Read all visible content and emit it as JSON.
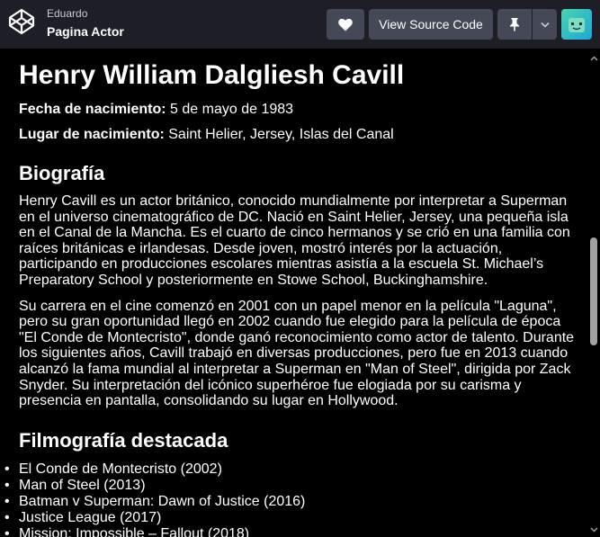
{
  "header": {
    "author": "Eduardo",
    "pen_title": "Pagina Actor",
    "source_label": "View Source Code"
  },
  "page": {
    "name": "Henry William Dalgliesh Cavill",
    "birth_label": "Fecha de nacimiento:",
    "birth_value": " 5 de mayo de 1983",
    "place_label": "Lugar de nacimiento:",
    "place_value": " Saint Helier, Jersey, Islas del Canal",
    "bio_heading": "Biografía",
    "bio_p1": "Henry Cavill es un actor británico, conocido mundialmente por interpretar a Superman en el universo cinematográfico de DC. Nació en Saint Helier, Jersey, una pequeña isla en el Canal de la Mancha. Es el cuarto de cinco hermanos y se crió en una familia con raíces británicas e irlandesas. Desde joven, mostró interés por la actuación, participando en producciones escolares mientras asistía a la escuela St. Michael’s Preparatory School y posteriormente en Stowe School, Buckinghamshire.",
    "bio_p2": "Su carrera en el cine comenzó en 2001 con un papel menor en la película \"Laguna\", pero su gran oportunidad llegó en 2002 cuando fue elegido para la película de época \"El Conde de Montecristo\", donde ganó reconocimiento como actor de talento. Durante los siguientes años, Cavill trabajó en diversas producciones, pero fue en 2013 cuando alcanzó la fama mundial al interpretar a Superman en \"Man of Steel\", dirigida por Zack Snyder. Su interpretación del icónico superhéroe fue elogiada por su carisma y presencia en pantalla, consolidando su lugar en Hollywood.",
    "films_heading": "Filmografía destacada",
    "films": [
      "El Conde de Montecristo (2002)",
      "Man of Steel (2013)",
      "Batman v Superman: Dawn of Justice (2016)",
      "Justice League (2017)",
      "Mission: Impossible – Fallout (2018)"
    ]
  },
  "icons": [
    "codepen-logo-icon",
    "heart-icon",
    "pin-icon",
    "chevron-down-icon",
    "avatar"
  ],
  "colors": {
    "topbar": "#1e1f26",
    "button": "#444857",
    "page_bg": "#000000"
  }
}
